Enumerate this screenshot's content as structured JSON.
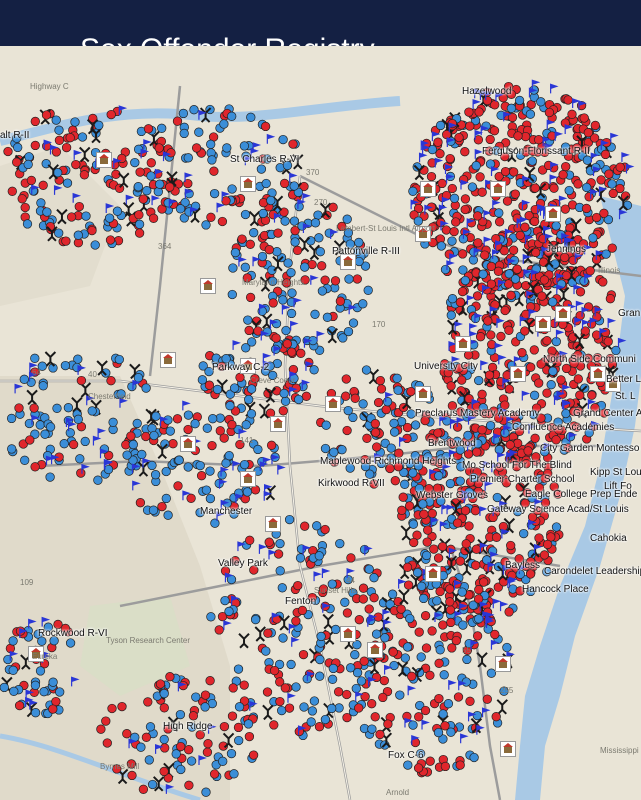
{
  "header": {
    "title": "Sex Offender Registry"
  },
  "colors": {
    "header_bg": "#142043",
    "offender_red": "#e0262c",
    "offender_blue": "#3b8ed8",
    "school_flag": "#2a37d6",
    "river": "#a9c9e5",
    "terrain": "#e9e4d6"
  },
  "icons": [
    "offender-red-dot",
    "offender-blue-dot",
    "school-flag-icon",
    "school-building-icon",
    "offender-figure-icon"
  ],
  "map": {
    "district_labels": [
      "Hazelwood",
      "Ferguson-Florissant R-II",
      "St Charles R-VI",
      "Pattonville R-III",
      "Jennings",
      "North Side Communi",
      "University City",
      "Parkway C-2",
      "Better L",
      "Preclarus Mastery Academy",
      "Grand Center A",
      "Confluence Academies",
      "Brentwood",
      "City Garden Montesso",
      "Maplewood-Richmond Heights",
      "Mo School For The Blind",
      "Kipp St Louis",
      "Premier Charter School",
      "Lift Fo",
      "Kirkwood R-VII",
      "Webster Groves",
      "Eagle College Prep Ende",
      "Gateway Science Acad/St Louis",
      "Manchester",
      "Valley Park",
      "Bayless",
      "Carondelet Leadership A",
      "Cahokia",
      "Hancock Place",
      "Rockwood R-VI",
      "Fenton",
      "Fox C-6",
      "High Ridge",
      "St. L",
      "Gran",
      "alt R-II"
    ],
    "base_labels": [
      "Lambert-St Louis Intl Airport",
      "Creve Coeur",
      "Maryland Heights",
      "Chesterfield",
      "Sunset Hills",
      "Tyson Research Center",
      "Eureka",
      "Byrnes Mill",
      "Arnold",
      "Illinois",
      "Mississippi",
      "Highway C",
      "370",
      "270",
      "364",
      "64",
      "40",
      "44",
      "141",
      "109",
      "55",
      "255",
      "170"
    ]
  }
}
